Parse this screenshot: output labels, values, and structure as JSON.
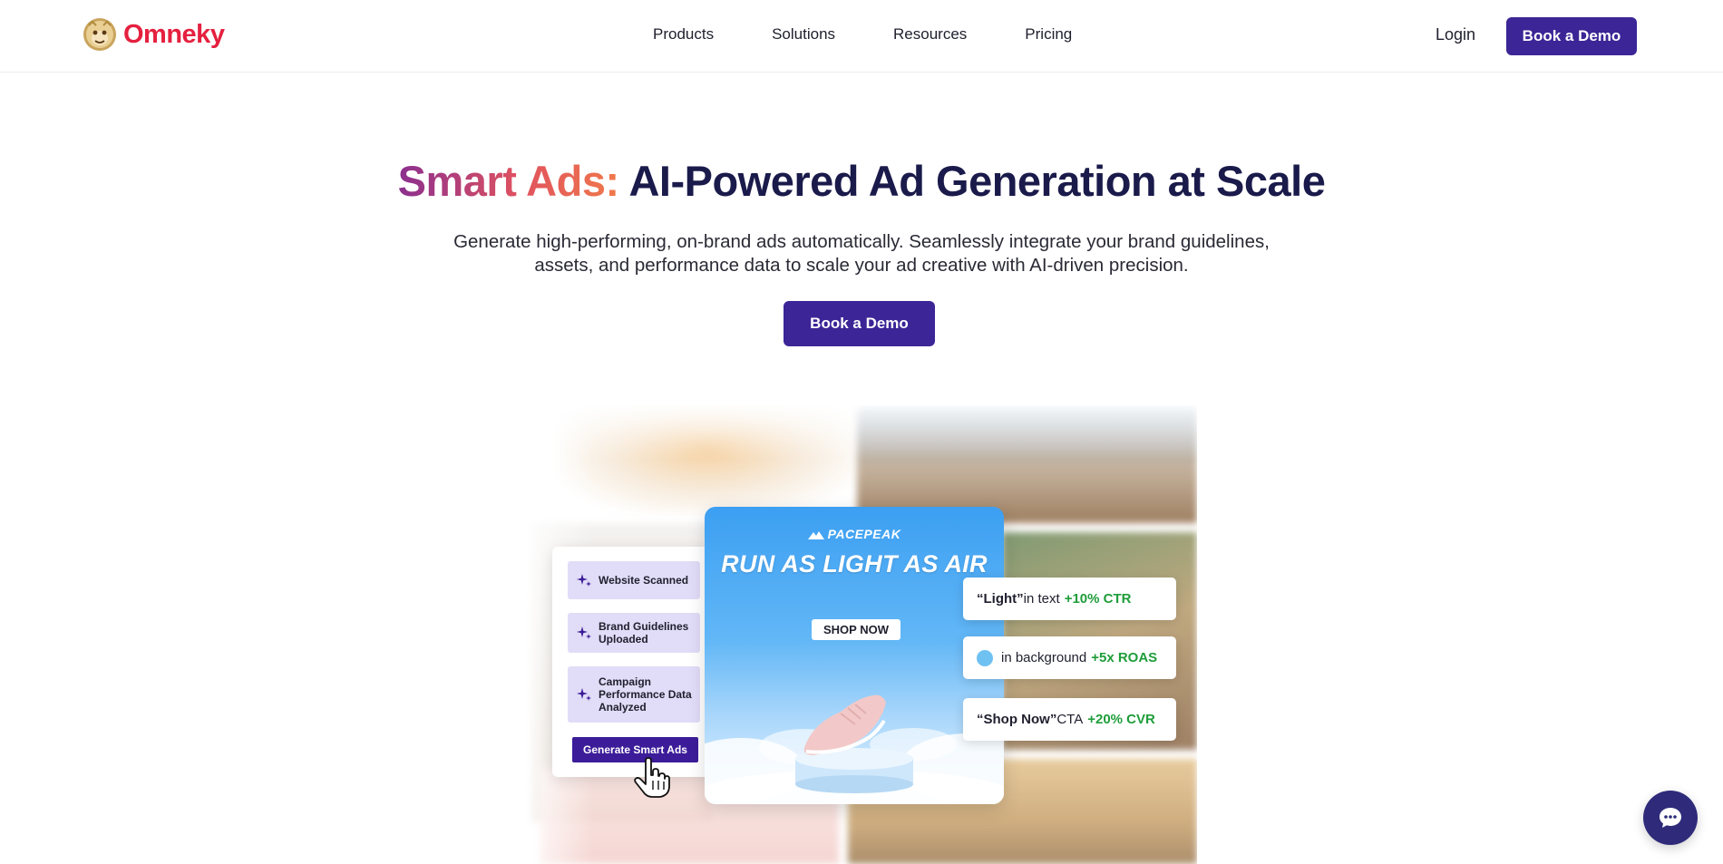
{
  "header": {
    "logo_text": "Omneky",
    "nav": [
      "Products",
      "Solutions",
      "Resources",
      "Pricing"
    ],
    "login_label": "Login",
    "cta_label": "Book a Demo"
  },
  "hero": {
    "title_highlight": "Smart Ads:",
    "title_rest": " AI-Powered Ad Generation at Scale",
    "subtitle": "Generate high-performing, on-brand ads automatically. Seamlessly integrate your brand guidelines, assets, and performance data to scale your ad creative with AI-driven precision.",
    "cta_label": "Book a Demo"
  },
  "checklist": {
    "items": [
      "Website Scanned",
      "Brand Guidelines Uploaded",
      "Campaign Performance Data Analyzed"
    ],
    "button_label": "Generate Smart Ads"
  },
  "ad": {
    "brand": "PACEPEAK",
    "headline": "RUN AS LIGHT AS AIR",
    "cta": "SHOP NOW"
  },
  "insights": [
    {
      "quote": "“Light”",
      "text": " in text",
      "metric": "+10% CTR"
    },
    {
      "quote": "",
      "text": "in background",
      "metric": "+5x ROAS"
    },
    {
      "quote": "“Shop Now”",
      "text": " CTA",
      "metric": "+20% CVR"
    }
  ],
  "colors": {
    "brand_red": "#e5203f",
    "primary_purple": "#3c2596",
    "metric_green": "#1f9d3a",
    "title_navy": "#1a1a4b"
  },
  "icons": [
    "monkey-logo-icon",
    "sparkle-icon",
    "hand-cursor-icon",
    "chat-icon"
  ]
}
